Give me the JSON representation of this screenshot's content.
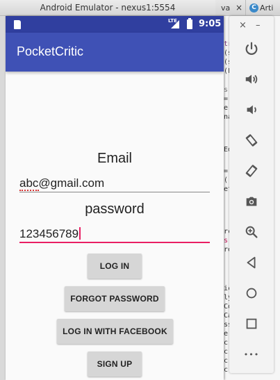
{
  "window": {
    "title": "Android Emulator - nexus1:5554"
  },
  "ide": {
    "tabs": [
      {
        "label": "va",
        "close": "×"
      },
      {
        "label": "Arti",
        "icon": "C"
      }
    ],
    "code_fragments": [
      "tre",
      "(s",
      "(s",
      "(F",
      "s",
      "=",
      "e",
      "na",
      "Ed",
      "=",
      "(",
      "et",
      "rch",
      "s",
      "reb",
      "ica",
      "ly",
      "Cor",
      "Cal",
      "ss",
      "e",
      "c",
      "c",
      "c",
      "c"
    ]
  },
  "statusbar": {
    "network": "LTE",
    "time": "9:05"
  },
  "app": {
    "title": "PocketCritic",
    "email_label": "Email",
    "email_value": "abc@gmail.com",
    "password_label": "password",
    "password_value": "123456789",
    "buttons": {
      "login": "LOG IN",
      "forgot": "FORGOT PASSWORD",
      "facebook": "LOG IN WITH FACEBOOK",
      "signup": "SIGN UP"
    }
  },
  "emulator_toolbar": {
    "close": "×",
    "minimize": "–",
    "more": "•••",
    "icons": [
      "power-icon",
      "volume-up-icon",
      "volume-down-icon",
      "rotate-left-icon",
      "rotate-right-icon",
      "camera-icon",
      "zoom-icon",
      "back-icon",
      "home-icon",
      "overview-icon",
      "more-icon"
    ]
  },
  "colors": {
    "status": "#303f9f",
    "appbar": "#3f51b5",
    "accent": "#e91e63"
  }
}
